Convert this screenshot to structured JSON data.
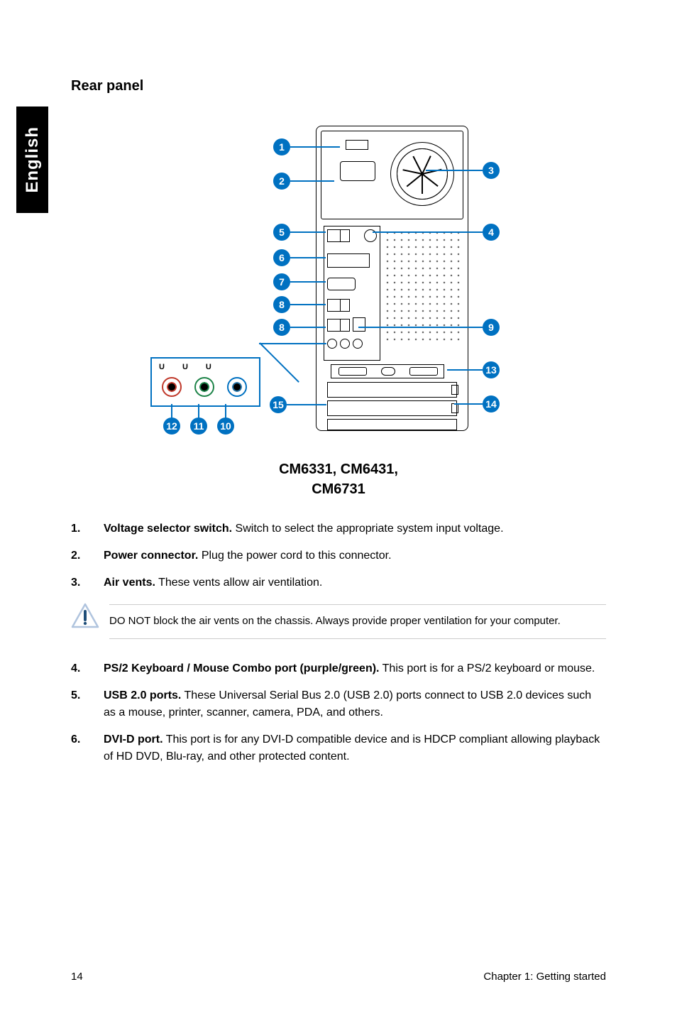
{
  "side_tab": "English",
  "section_title": "Rear panel",
  "figure": {
    "caption_line1": "CM6331, CM6431,",
    "caption_line2": "CM6731",
    "callouts": {
      "c1": "1",
      "c2": "2",
      "c3": "3",
      "c4": "4",
      "c5": "5",
      "c6": "6",
      "c7": "7",
      "c8a": "8",
      "c8b": "8",
      "c9": "9",
      "c10": "10",
      "c11": "11",
      "c12": "12",
      "c13": "13",
      "c14": "14",
      "c15": "15"
    },
    "inset_symbols": [
      "U",
      "U",
      "U"
    ]
  },
  "list": [
    {
      "num": "1.",
      "title": "Voltage selector switch.",
      "desc": " Switch to select the appropriate system input voltage."
    },
    {
      "num": "2.",
      "title": "Power connector.",
      "desc": " Plug the power cord to this connector."
    },
    {
      "num": "3.",
      "title": "Air vents.",
      "desc": " These vents allow air ventilation."
    }
  ],
  "note": "DO NOT block the air vents on the chassis. Always provide proper ventilation for your computer.",
  "list2": [
    {
      "num": "4.",
      "title": "PS/2 Keyboard / Mouse Combo port (purple/green).",
      "desc": " This port is for a PS/2 keyboard or mouse."
    },
    {
      "num": "5.",
      "title": "USB 2.0 ports.",
      "desc": " These Universal Serial Bus 2.0 (USB 2.0) ports connect to USB 2.0 devices such as a mouse, printer, scanner, camera, PDA, and others."
    },
    {
      "num": "6.",
      "title": "DVI-D port.",
      "desc": " This port is for any DVI-D compatible device and is HDCP compliant allowing playback of HD DVD, Blu-ray, and other protected content."
    }
  ],
  "footer": {
    "page": "14",
    "chapter": "Chapter 1: Getting started"
  }
}
